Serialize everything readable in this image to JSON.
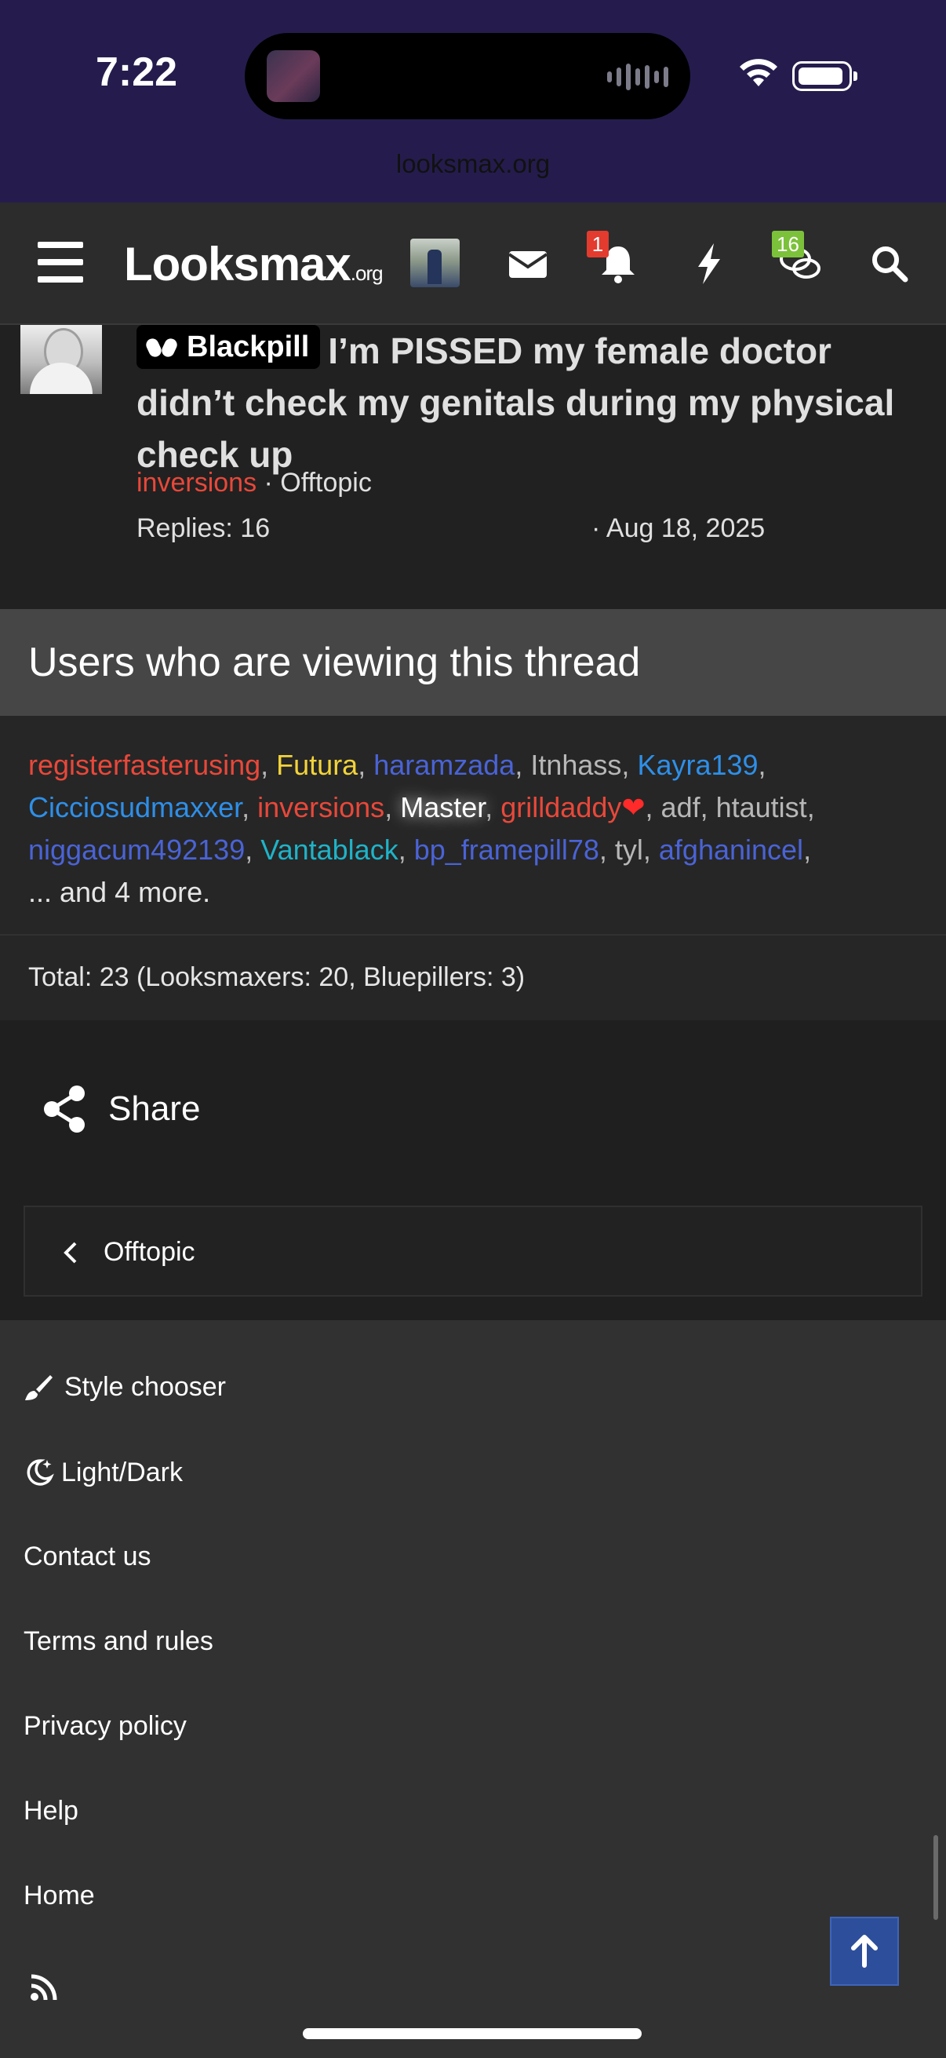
{
  "status_bar": {
    "time": "7:22",
    "battery_level": 0.8
  },
  "browser": {
    "url": "looksmax.org"
  },
  "nav": {
    "logo_main": "Looksmax",
    "logo_suffix": ".org",
    "alerts_badge": "1",
    "conversations_badge": "16",
    "icons": [
      "menu-icon",
      "envelope-icon",
      "bell-icon",
      "bolt-icon",
      "comments-icon",
      "search-icon"
    ]
  },
  "thread": {
    "prefix": "Blackpill",
    "title": "I’m PISSED my female doctor didn’t check my genitals during my physical check up",
    "author": "inversions",
    "forum": "· Offtopic",
    "replies": "Replies: 16",
    "date": "· Aug 18, 2025"
  },
  "viewers": {
    "heading": "Users who are viewing this thread",
    "users": [
      {
        "name": "registerfasterusing",
        "color": "#e8483a"
      },
      {
        "name": "Futura",
        "color": "#f2d33a"
      },
      {
        "name": "haramzada",
        "color": "#4a63d6"
      },
      {
        "name": "Itnhass",
        "color": "#b7b7b7"
      },
      {
        "name": "Kayra139",
        "color": "#2e8fe8"
      },
      {
        "name": "Cicciosudmaxxer",
        "color": "#2e8fe8"
      },
      {
        "name": "inversions",
        "color": "#e8483a"
      },
      {
        "name": "Master",
        "color": "#ffffff"
      },
      {
        "name": "grilldaddy",
        "color": "#e8483a"
      },
      {
        "name": "adf",
        "color": "#b7b7b7"
      },
      {
        "name": "htautist",
        "color": "#b7b7b7"
      },
      {
        "name": "niggacum492139",
        "color": "#4a63d6"
      },
      {
        "name": "Vantablack",
        "color": "#1fb3c8"
      },
      {
        "name": "bp_framepill78",
        "color": "#4a63d6"
      },
      {
        "name": "tyl",
        "color": "#b7b7b7"
      },
      {
        "name": "afghanincel",
        "color": "#4a63d6"
      }
    ],
    "more": "... and 4 more.",
    "total": "Total: 23 (Looksmaxers: 20, Bluepillers: 3)"
  },
  "share_label": "Share",
  "breadcrumb_label": "Offtopic",
  "footer": {
    "style_chooser": "Style chooser",
    "light_dark": "Light/Dark",
    "contact": "Contact us",
    "terms": "Terms and rules",
    "privacy": "Privacy policy",
    "help": "Help",
    "home": "Home"
  },
  "colors": {
    "status_bar_bg": "#251c4d",
    "accent_red": "#e8483a",
    "scroll_top_button": "#2d4f9b",
    "alert_badge": "#e33b2e",
    "conversation_badge": "#7cc13a"
  }
}
